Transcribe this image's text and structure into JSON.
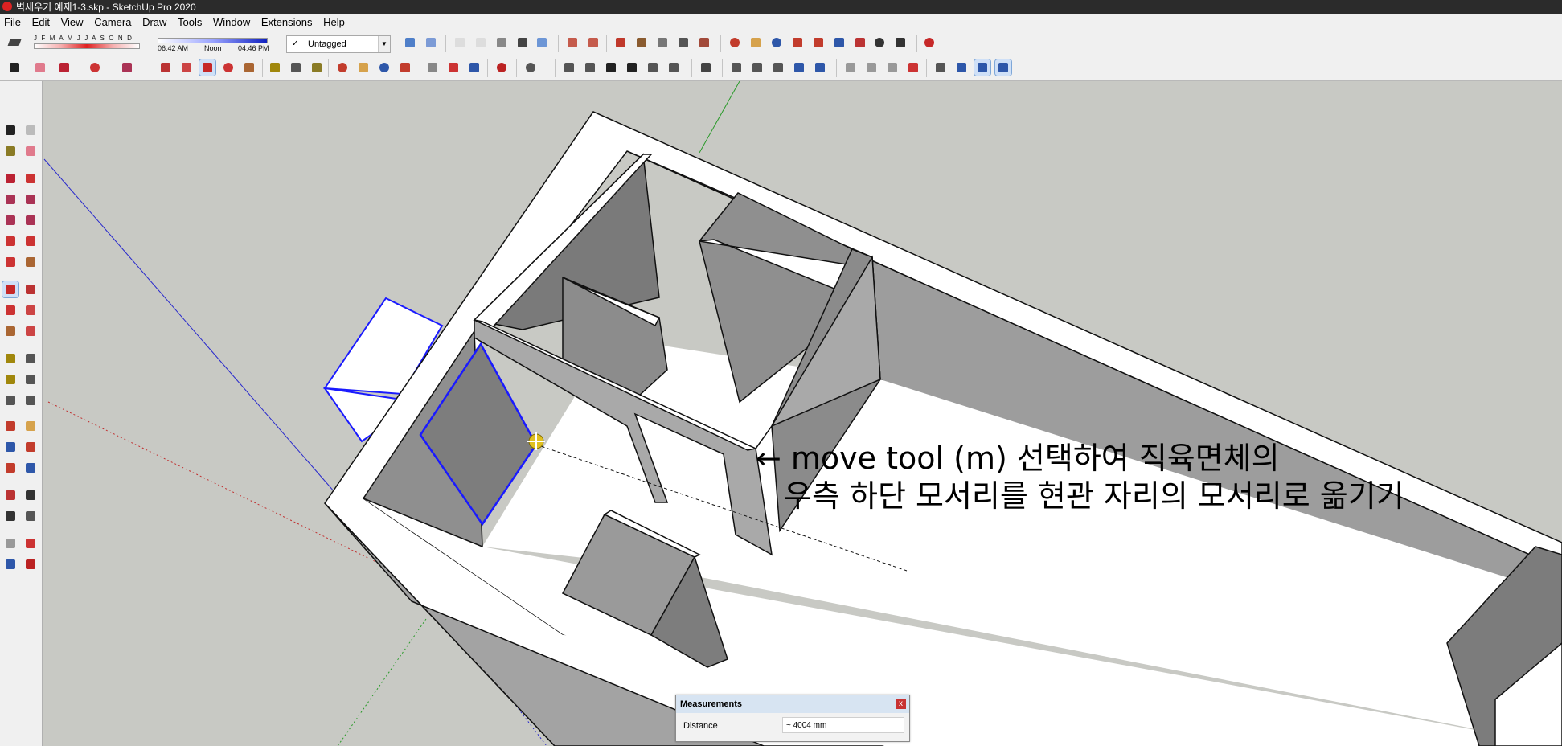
{
  "window": {
    "title": "벽세우기 예제1-3.skp - SketchUp Pro 2020"
  },
  "menu": {
    "items": [
      "File",
      "Edit",
      "View",
      "Camera",
      "Draw",
      "Tools",
      "Window",
      "Extensions",
      "Help"
    ]
  },
  "shadows": {
    "months": "J F M A M J J A S O N D",
    "time_start": "06:42 AM",
    "time_mid": "Noon",
    "time_end": "04:46 PM"
  },
  "tags": {
    "current": "Untagged"
  },
  "annotation": {
    "line1": "← move tool (m) 선택하여 직육면체의",
    "line2": "우측 하단 모서리를 현관 자리의 모서리로 옮기기"
  },
  "measurements": {
    "title": "Measurements",
    "label": "Distance",
    "value": "~ 4004 mm"
  },
  "colors": {
    "axis_blue": "#0000ff",
    "axis_red": "#c00000",
    "axis_green": "#00a000",
    "selection": "#0000ff",
    "viewport_bg": "#c8c9c4"
  }
}
